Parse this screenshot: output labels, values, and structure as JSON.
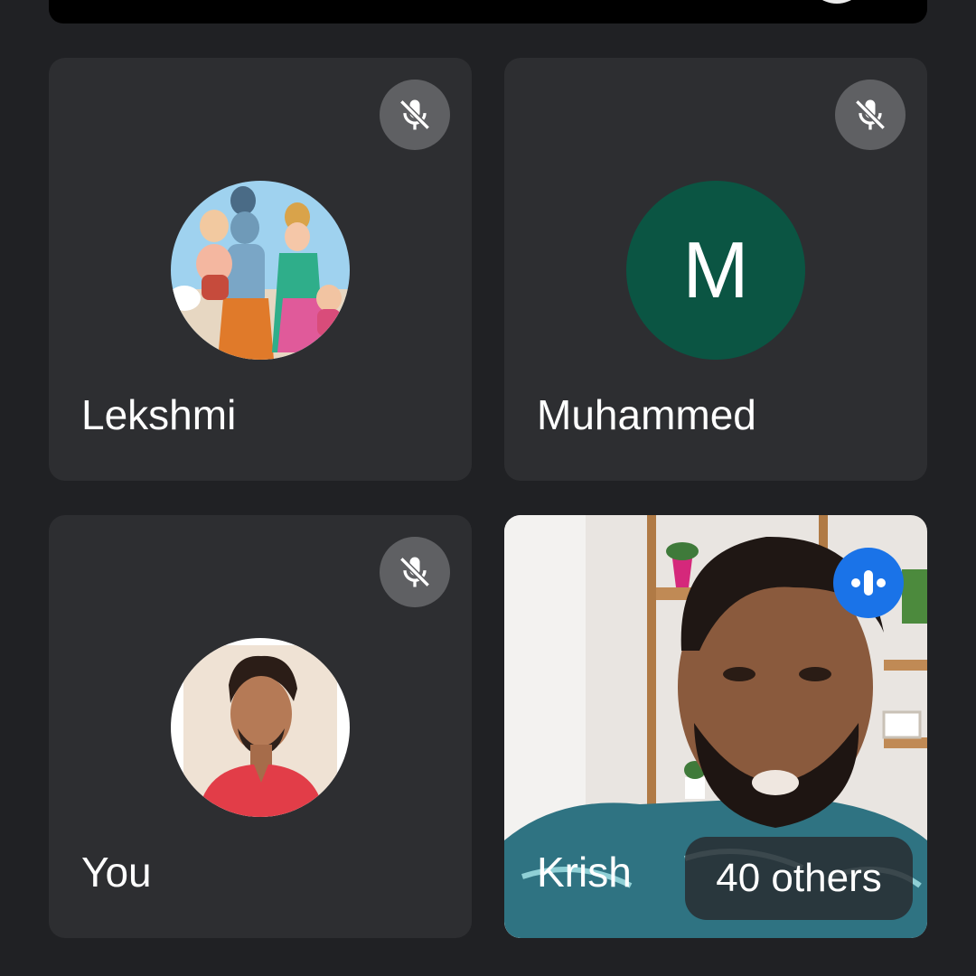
{
  "participants": [
    {
      "name": "Lekshmi",
      "avatar": "photo",
      "muted": true
    },
    {
      "name": "Muhammed",
      "avatar_letter": "M",
      "avatar_color": "#0b5543",
      "muted": true
    },
    {
      "name": "You",
      "avatar": "photo",
      "muted": true
    },
    {
      "name": "Krish",
      "video": "camera-feed",
      "speaking": true
    }
  ],
  "overflow": {
    "label": "40 others"
  },
  "colors": {
    "background": "#202124",
    "tile": "#2d2e31",
    "speaking_badge": "#1a73e8",
    "mute_badge": "#5f6063"
  }
}
